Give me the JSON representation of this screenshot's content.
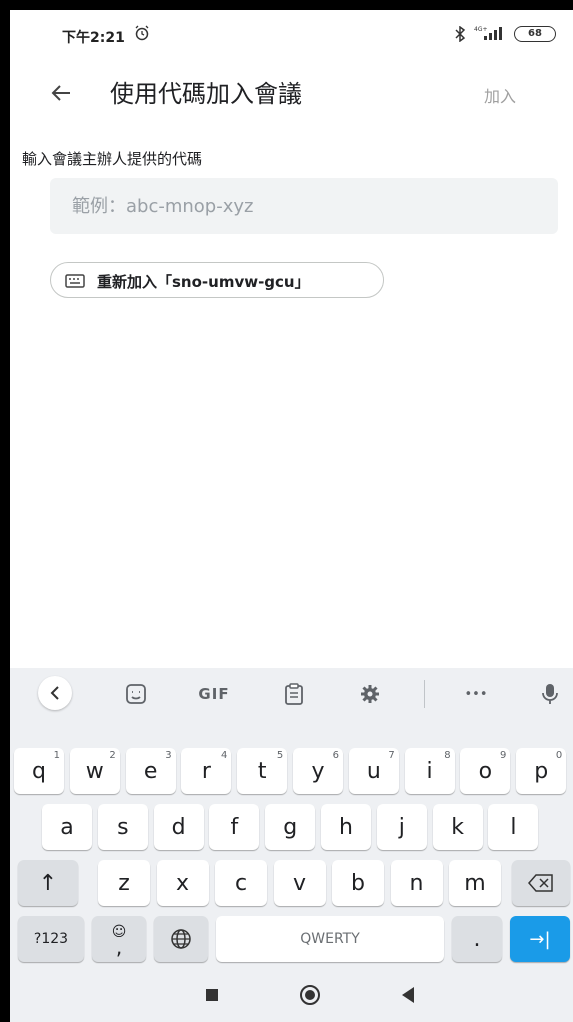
{
  "status_bar": {
    "time": "下午2:21",
    "network": "4G+",
    "battery": "68"
  },
  "app_bar": {
    "title": "使用代碼加入會議",
    "join_label": "加入"
  },
  "form": {
    "instruction": "輸入會議主辦人提供的代碼",
    "code_value": "",
    "code_placeholder": "範例：abc-mnop-xyz",
    "rejoin_label": "重新加入「sno-umvw-gcu」"
  },
  "keyboard": {
    "toolbar": {
      "gif_label": "GIF",
      "more_label": "•••"
    },
    "row1": [
      {
        "key": "q",
        "hint": "1"
      },
      {
        "key": "w",
        "hint": "2"
      },
      {
        "key": "e",
        "hint": "3"
      },
      {
        "key": "r",
        "hint": "4"
      },
      {
        "key": "t",
        "hint": "5"
      },
      {
        "key": "y",
        "hint": "6"
      },
      {
        "key": "u",
        "hint": "7"
      },
      {
        "key": "i",
        "hint": "8"
      },
      {
        "key": "o",
        "hint": "9"
      },
      {
        "key": "p",
        "hint": "0"
      }
    ],
    "row2": [
      "a",
      "s",
      "d",
      "f",
      "g",
      "h",
      "j",
      "k",
      "l"
    ],
    "row3": [
      "z",
      "x",
      "c",
      "v",
      "b",
      "n",
      "m"
    ],
    "shift_label": "↑",
    "symbols_label": "?123",
    "emoji_key_top": "☺",
    "emoji_key_bottom": ",",
    "space_label": "QWERTY",
    "period_label": ".",
    "enter_label": "→|"
  },
  "icons": {
    "back": "arrow-left-icon",
    "alarm": "alarm-clock-icon",
    "bluetooth": "bluetooth-icon",
    "signal": "cell-signal-icon",
    "battery": "battery-icon",
    "keyboard": "keyboard-icon",
    "sticker": "sticker-icon",
    "clipboard": "clipboard-icon",
    "settings": "gear-icon",
    "mic": "microphone-icon",
    "globe": "globe-icon",
    "backspace": "backspace-icon"
  },
  "colors": {
    "enter_key": "#1a9be8",
    "field_bg": "#f1f3f4",
    "disabled_text": "#a0a0a0"
  }
}
